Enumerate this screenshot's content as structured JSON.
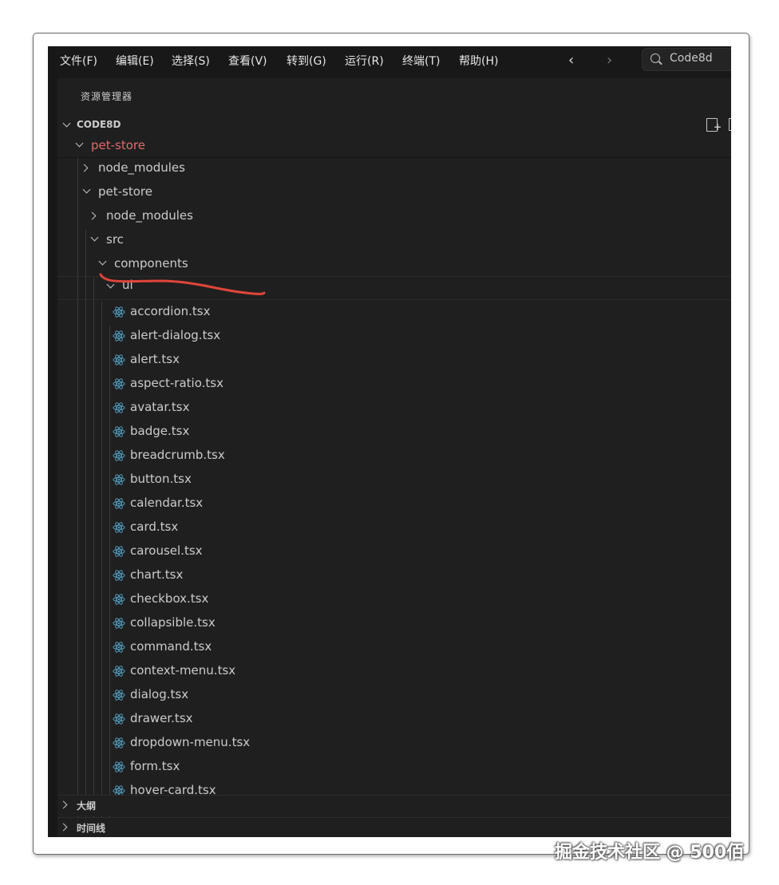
{
  "menu": [
    "文件(F)",
    "编辑(E)",
    "选择(S)",
    "查看(V)",
    "转到(G)",
    "运行(R)",
    "终端(T)",
    "帮助(H)"
  ],
  "search": {
    "text": "Code8d"
  },
  "explorer": {
    "title": "资源管理器",
    "root": "CODE8D"
  },
  "tree": [
    {
      "label": "pet-store",
      "expanded": true,
      "type": "folder",
      "color": "#e06c6c"
    },
    {
      "label": "node_modules",
      "expanded": false,
      "type": "folder"
    },
    {
      "label": "pet-store",
      "expanded": true,
      "type": "folder"
    },
    {
      "label": "node_modules",
      "expanded": false,
      "type": "folder"
    },
    {
      "label": "src",
      "expanded": true,
      "type": "folder"
    },
    {
      "label": "components",
      "expanded": true,
      "type": "folder"
    },
    {
      "label": "ui",
      "expanded": true,
      "type": "folder"
    }
  ],
  "files": [
    "accordion.tsx",
    "alert-dialog.tsx",
    "alert.tsx",
    "aspect-ratio.tsx",
    "avatar.tsx",
    "badge.tsx",
    "breadcrumb.tsx",
    "button.tsx",
    "calendar.tsx",
    "card.tsx",
    "carousel.tsx",
    "chart.tsx",
    "checkbox.tsx",
    "collapsible.tsx",
    "command.tsx",
    "context-menu.tsx",
    "dialog.tsx",
    "drawer.tsx",
    "dropdown-menu.tsx",
    "form.tsx",
    "hover-card.tsx"
  ],
  "panels": [
    "大纲",
    "时间线"
  ],
  "watermark": "掘金技术社区 @ 500佰",
  "colors": {
    "accent_red": "#e0453a",
    "react_icon": "#519aba",
    "text": "#cccccc"
  }
}
